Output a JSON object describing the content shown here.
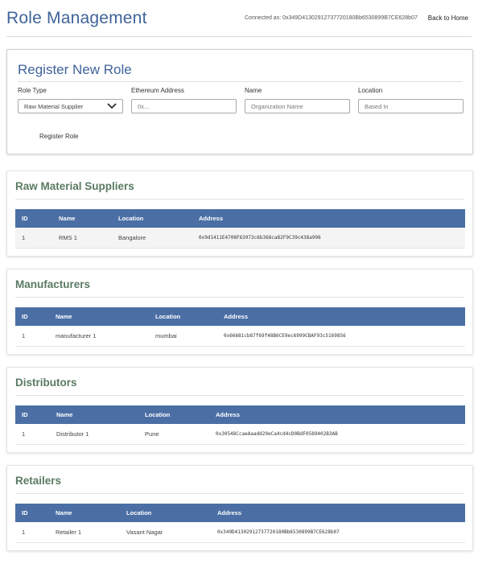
{
  "header": {
    "title": "Role Management",
    "connected_text": "Connected as: 0x349D41302912737720180Bb6530899B7CE628b07",
    "back_label": "Back to Home"
  },
  "register": {
    "title": "Register New Role",
    "fields": {
      "role_type": {
        "label": "Role Type",
        "value": "Raw Material Supplier"
      },
      "address": {
        "label": "Ethereum Address",
        "placeholder": "0x..."
      },
      "name": {
        "label": "Name",
        "placeholder": "Organization Name"
      },
      "location": {
        "label": "Location",
        "placeholder": "Based In"
      }
    },
    "button_label": "Register Role"
  },
  "columns": {
    "id": "ID",
    "name": "Name",
    "location": "Location",
    "address": "Address"
  },
  "sections": [
    {
      "title": "Raw Material Suppliers",
      "rows": [
        {
          "id": "1",
          "name": "RMS 1",
          "location": "Bangalore",
          "address": "0x9d1411E4708F63973c6b368ca82F9C39c438a996"
        }
      ]
    },
    {
      "title": "Manufacturers",
      "rows": [
        {
          "id": "1",
          "name": "manufacturer 1",
          "location": "mumbai",
          "address": "0x66681cb87f69f48B6CE9ec6999CBAF93c5169856"
        }
      ]
    },
    {
      "title": "Distributors",
      "rows": [
        {
          "id": "1",
          "name": "Distributor 1",
          "location": "Pune",
          "address": "0x30548CcaeAaadd29eCa4cd4cD0BdF0589402B3AB"
        }
      ]
    },
    {
      "title": "Retailers",
      "rows": [
        {
          "id": "1",
          "name": "Retailer 1",
          "location": "Vasant Nagar",
          "address": "0x349D41302912737720180Bb6530899B7CE628b07"
        }
      ]
    }
  ]
}
